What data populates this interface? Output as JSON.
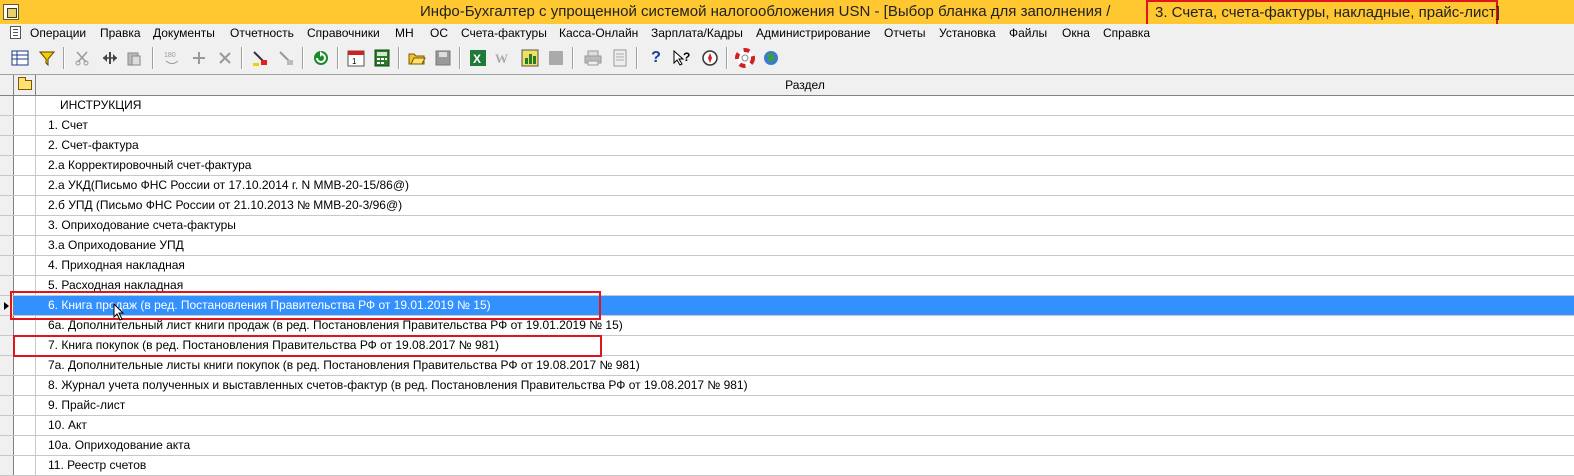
{
  "window": {
    "title": "Инфо-Бухгалтер с упрощенной системой налогообложения  USN   - [Выбор бланка для заполнения /",
    "title_highlight": "3. Счета, счета-фактуры, накладные, прайс-лист]",
    "title_bar_color": "#ffc830",
    "highlight_color": "#e0141c"
  },
  "menu": [
    "Операции",
    "Правка",
    "Документы",
    "Отчетность",
    "Справочники",
    "МН",
    "ОС",
    "Счета-фактуры",
    "Касса-Онлайн",
    "Зарплата/Кадры",
    "Администрирование",
    "Отчеты",
    "Установка",
    "Файлы",
    "Окна",
    "Справка"
  ],
  "toolbar": {
    "icons": [
      "grid-icon",
      "filter-icon",
      "cut-icon",
      "move-icon",
      "paste-icon",
      "rotate-icon",
      "add-icon",
      "delete-icon",
      "mark-icon",
      "unmark-icon",
      "refresh-icon",
      "calendar-icon",
      "calculator-icon",
      "open-folder-icon",
      "save-icon",
      "excel-icon",
      "word-icon",
      "chart-icon",
      "stop-icon",
      "print-icon",
      "preview-icon",
      "help-icon",
      "context-help-icon",
      "compass-icon",
      "lifebuoy-icon",
      "globe-icon"
    ]
  },
  "grid": {
    "column_header": "Раздел",
    "selected_color": "#3390ff",
    "rows": [
      "ИНСТРУКЦИЯ",
      "1. Счет",
      "2. Счет-фактура",
      "2.а Корректировочный счет-фактура",
      "2.а УКД(Письмо ФНС России от 17.10.2014 г. N ММВ-20-15/86@)",
      "2.б УПД (Письмо ФНС России от 21.10.2013 № ММВ-20-3/96@)",
      "3. Оприходование счета-фактуры",
      "3.а Оприходование УПД",
      "4. Приходная накладная",
      "5. Расходная накладная",
      "6. Книга продаж (в ред. Постановления Правительства РФ от 19.01.2019 № 15)",
      "6а. Дополнительный лист книги продаж (в ред. Постановления Правительства РФ от 19.01.2019 № 15)",
      "7. Книга покупок (в ред. Постановления Правительства РФ от 19.08.2017 № 981)",
      "7а. Дополнительные листы книги покупок (в ред. Постановления Правительства РФ от 19.08.2017 № 981)",
      "8. Журнал учета полученных и выставленных счетов-фактур (в ред. Постановления Правительства РФ от 19.08.2017 № 981)",
      "9. Прайс-лист",
      "10. Акт",
      "10а. Оприходование акта",
      "11. Реестр счетов"
    ],
    "selected_index": 10
  }
}
